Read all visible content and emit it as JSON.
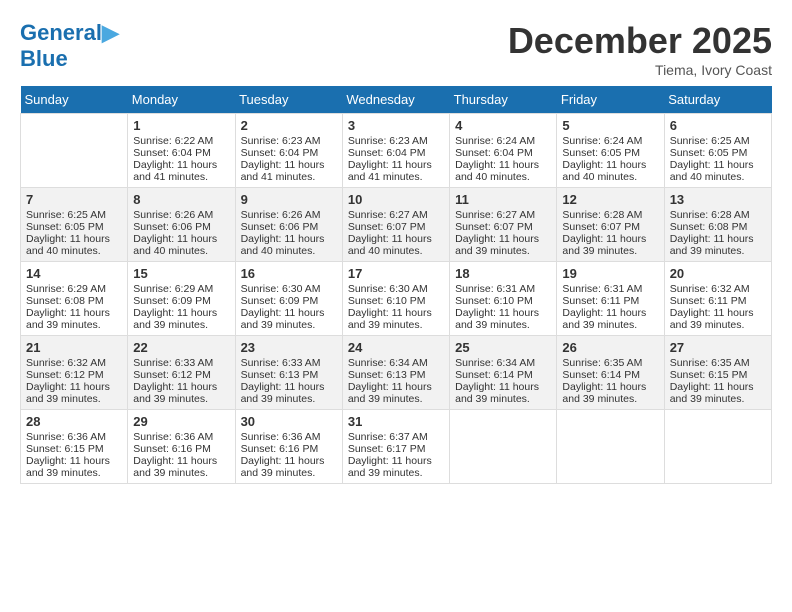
{
  "header": {
    "logo_line1": "General",
    "logo_line2": "Blue",
    "month": "December 2025",
    "location": "Tiema, Ivory Coast"
  },
  "weekdays": [
    "Sunday",
    "Monday",
    "Tuesday",
    "Wednesday",
    "Thursday",
    "Friday",
    "Saturday"
  ],
  "weeks": [
    [
      {
        "day": "",
        "empty": true
      },
      {
        "day": "1",
        "sunrise": "6:22 AM",
        "sunset": "6:04 PM",
        "daylight": "11 hours and 41 minutes."
      },
      {
        "day": "2",
        "sunrise": "6:23 AM",
        "sunset": "6:04 PM",
        "daylight": "11 hours and 41 minutes."
      },
      {
        "day": "3",
        "sunrise": "6:23 AM",
        "sunset": "6:04 PM",
        "daylight": "11 hours and 41 minutes."
      },
      {
        "day": "4",
        "sunrise": "6:24 AM",
        "sunset": "6:04 PM",
        "daylight": "11 hours and 40 minutes."
      },
      {
        "day": "5",
        "sunrise": "6:24 AM",
        "sunset": "6:05 PM",
        "daylight": "11 hours and 40 minutes."
      },
      {
        "day": "6",
        "sunrise": "6:25 AM",
        "sunset": "6:05 PM",
        "daylight": "11 hours and 40 minutes."
      }
    ],
    [
      {
        "day": "7",
        "sunrise": "6:25 AM",
        "sunset": "6:05 PM",
        "daylight": "11 hours and 40 minutes."
      },
      {
        "day": "8",
        "sunrise": "6:26 AM",
        "sunset": "6:06 PM",
        "daylight": "11 hours and 40 minutes."
      },
      {
        "day": "9",
        "sunrise": "6:26 AM",
        "sunset": "6:06 PM",
        "daylight": "11 hours and 40 minutes."
      },
      {
        "day": "10",
        "sunrise": "6:27 AM",
        "sunset": "6:07 PM",
        "daylight": "11 hours and 40 minutes."
      },
      {
        "day": "11",
        "sunrise": "6:27 AM",
        "sunset": "6:07 PM",
        "daylight": "11 hours and 39 minutes."
      },
      {
        "day": "12",
        "sunrise": "6:28 AM",
        "sunset": "6:07 PM",
        "daylight": "11 hours and 39 minutes."
      },
      {
        "day": "13",
        "sunrise": "6:28 AM",
        "sunset": "6:08 PM",
        "daylight": "11 hours and 39 minutes."
      }
    ],
    [
      {
        "day": "14",
        "sunrise": "6:29 AM",
        "sunset": "6:08 PM",
        "daylight": "11 hours and 39 minutes."
      },
      {
        "day": "15",
        "sunrise": "6:29 AM",
        "sunset": "6:09 PM",
        "daylight": "11 hours and 39 minutes."
      },
      {
        "day": "16",
        "sunrise": "6:30 AM",
        "sunset": "6:09 PM",
        "daylight": "11 hours and 39 minutes."
      },
      {
        "day": "17",
        "sunrise": "6:30 AM",
        "sunset": "6:10 PM",
        "daylight": "11 hours and 39 minutes."
      },
      {
        "day": "18",
        "sunrise": "6:31 AM",
        "sunset": "6:10 PM",
        "daylight": "11 hours and 39 minutes."
      },
      {
        "day": "19",
        "sunrise": "6:31 AM",
        "sunset": "6:11 PM",
        "daylight": "11 hours and 39 minutes."
      },
      {
        "day": "20",
        "sunrise": "6:32 AM",
        "sunset": "6:11 PM",
        "daylight": "11 hours and 39 minutes."
      }
    ],
    [
      {
        "day": "21",
        "sunrise": "6:32 AM",
        "sunset": "6:12 PM",
        "daylight": "11 hours and 39 minutes."
      },
      {
        "day": "22",
        "sunrise": "6:33 AM",
        "sunset": "6:12 PM",
        "daylight": "11 hours and 39 minutes."
      },
      {
        "day": "23",
        "sunrise": "6:33 AM",
        "sunset": "6:13 PM",
        "daylight": "11 hours and 39 minutes."
      },
      {
        "day": "24",
        "sunrise": "6:34 AM",
        "sunset": "6:13 PM",
        "daylight": "11 hours and 39 minutes."
      },
      {
        "day": "25",
        "sunrise": "6:34 AM",
        "sunset": "6:14 PM",
        "daylight": "11 hours and 39 minutes."
      },
      {
        "day": "26",
        "sunrise": "6:35 AM",
        "sunset": "6:14 PM",
        "daylight": "11 hours and 39 minutes."
      },
      {
        "day": "27",
        "sunrise": "6:35 AM",
        "sunset": "6:15 PM",
        "daylight": "11 hours and 39 minutes."
      }
    ],
    [
      {
        "day": "28",
        "sunrise": "6:36 AM",
        "sunset": "6:15 PM",
        "daylight": "11 hours and 39 minutes."
      },
      {
        "day": "29",
        "sunrise": "6:36 AM",
        "sunset": "6:16 PM",
        "daylight": "11 hours and 39 minutes."
      },
      {
        "day": "30",
        "sunrise": "6:36 AM",
        "sunset": "6:16 PM",
        "daylight": "11 hours and 39 minutes."
      },
      {
        "day": "31",
        "sunrise": "6:37 AM",
        "sunset": "6:17 PM",
        "daylight": "11 hours and 39 minutes."
      },
      {
        "day": "",
        "empty": true
      },
      {
        "day": "",
        "empty": true
      },
      {
        "day": "",
        "empty": true
      }
    ]
  ]
}
